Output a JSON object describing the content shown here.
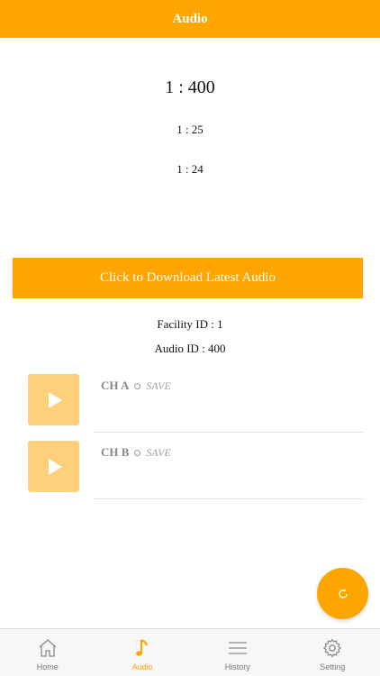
{
  "header": {
    "title": "Audio"
  },
  "ratios": {
    "main": "1 : 400",
    "sub1": "1 : 25",
    "sub2": "1 : 24"
  },
  "download_button": {
    "label": "Click to Download Latest Audio"
  },
  "info": {
    "facility": "Facility ID : 1",
    "audio": "Audio ID : 400"
  },
  "channels": [
    {
      "name": "CH A",
      "save_label": "SAVE",
      "icon": "play-icon"
    },
    {
      "name": "CH B",
      "save_label": "SAVE",
      "icon": "play-icon"
    }
  ],
  "fab": {
    "icon": "refresh-icon"
  },
  "tabs": [
    {
      "label": "Home",
      "icon": "home-icon",
      "active": false
    },
    {
      "label": "Audio",
      "icon": "music-note-icon",
      "active": true
    },
    {
      "label": "History",
      "icon": "menu-lines-icon",
      "active": false
    },
    {
      "label": "Setting",
      "icon": "gear-icon",
      "active": false
    }
  ],
  "colors": {
    "accent": "#ffa500",
    "play_button": "#ffd07a",
    "tabbar_bg": "#f7f7f7",
    "tab_inactive": "#777777"
  }
}
